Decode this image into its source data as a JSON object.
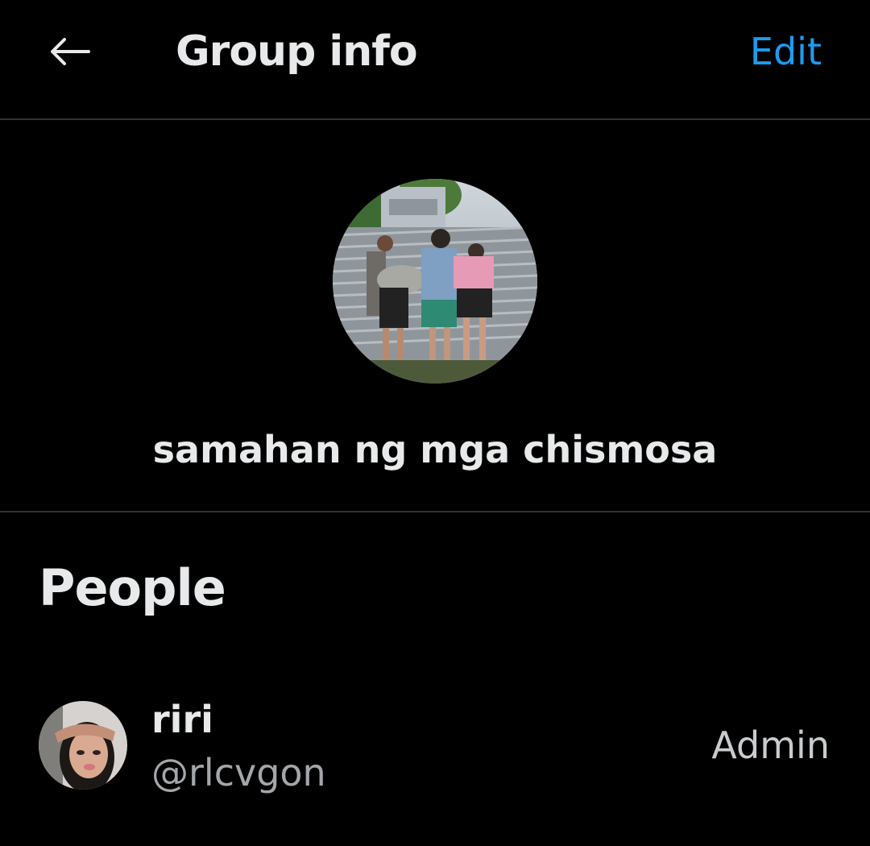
{
  "header": {
    "back_icon": "arrow-left-icon",
    "title": "Group info",
    "edit_label": "Edit"
  },
  "group": {
    "name": "samahan ng mga chismosa"
  },
  "people": {
    "section_title": "People",
    "members": [
      {
        "name": "riri",
        "handle": "@rlcvgon",
        "role": "Admin"
      }
    ]
  },
  "colors": {
    "background": "#000000",
    "accent": "#1d9bf0",
    "primary_text": "#e7e9ea",
    "secondary_text": "#a3a7ab",
    "divider": "#2f3336"
  }
}
